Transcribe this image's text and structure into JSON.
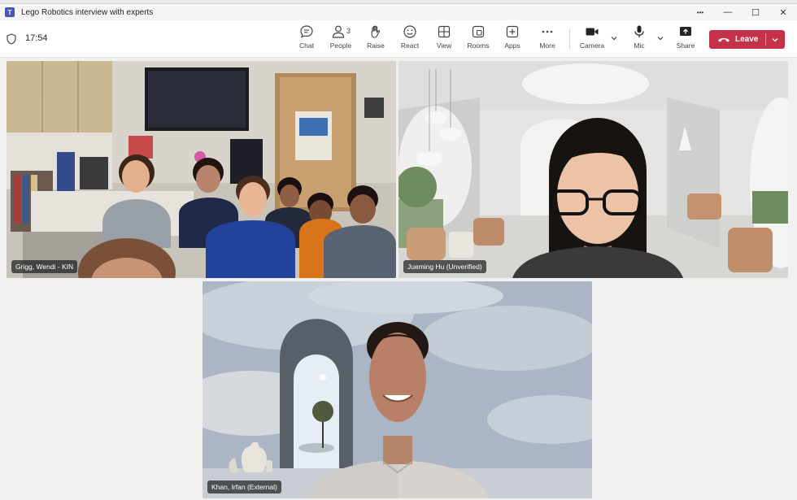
{
  "window": {
    "title": "Lego Robotics interview with experts",
    "app_icon_letter": "T",
    "more_glyph": "•••",
    "minimize_glyph": "—",
    "maximize_glyph": "☐",
    "close_glyph": "✕"
  },
  "meeting": {
    "timer": "17:54",
    "people_count": "3"
  },
  "toolbar": {
    "chat_label": "Chat",
    "people_label": "People",
    "raise_label": "Raise",
    "react_label": "React",
    "view_label": "View",
    "rooms_label": "Rooms",
    "apps_label": "Apps",
    "more_label": "More",
    "camera_label": "Camera",
    "mic_label": "Mic",
    "share_label": "Share",
    "leave_label": "Leave"
  },
  "participants": [
    {
      "name": "Grigg, Wendi - KIN"
    },
    {
      "name": "Jueming Hu (Unverified)"
    },
    {
      "name": "Khan, Irfan (External)"
    }
  ],
  "colors": {
    "leave_button": "#c4314b",
    "toolbar_bg": "#ffffff",
    "stage_bg": "#f0f0f0",
    "teams_purple": "#4b53bc"
  }
}
